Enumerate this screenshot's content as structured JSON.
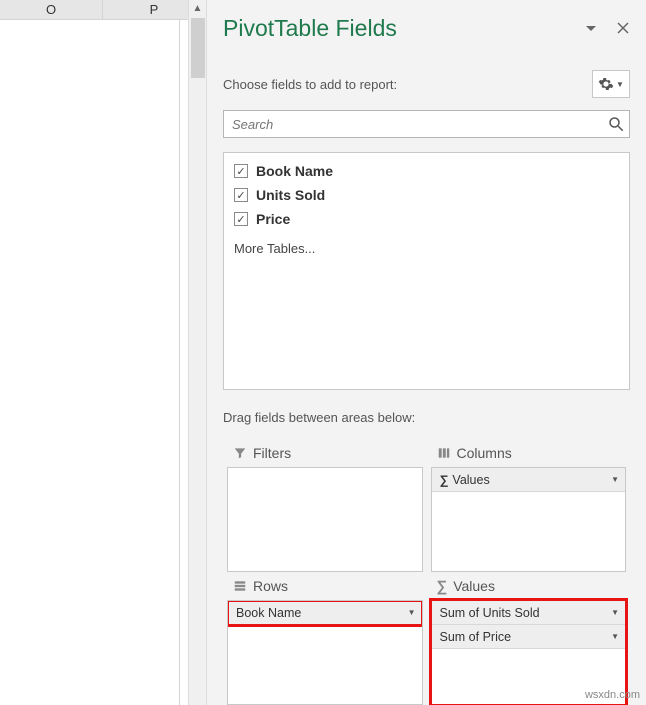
{
  "columns": [
    "O",
    "P"
  ],
  "pane": {
    "title": "PivotTable Fields",
    "subtitle": "Choose fields to add to report:",
    "search_placeholder": "Search",
    "more_tables": "More Tables...",
    "drag_label": "Drag fields between areas below:"
  },
  "fields": [
    {
      "label": "Book Name",
      "checked": true
    },
    {
      "label": "Units Sold",
      "checked": true
    },
    {
      "label": "Price",
      "checked": true
    }
  ],
  "areas": {
    "filters": {
      "label": "Filters",
      "items": []
    },
    "columns": {
      "label": "Columns",
      "items": [
        {
          "label": "Values",
          "sigma": true
        }
      ]
    },
    "rows": {
      "label": "Rows",
      "items": [
        {
          "label": "Book Name",
          "highlight": true
        }
      ]
    },
    "values": {
      "label": "Values",
      "items": [
        {
          "label": "Sum of Units Sold",
          "highlight": true
        },
        {
          "label": "Sum of Price",
          "highlight": true
        }
      ]
    }
  },
  "watermark": "wsxdn.com"
}
